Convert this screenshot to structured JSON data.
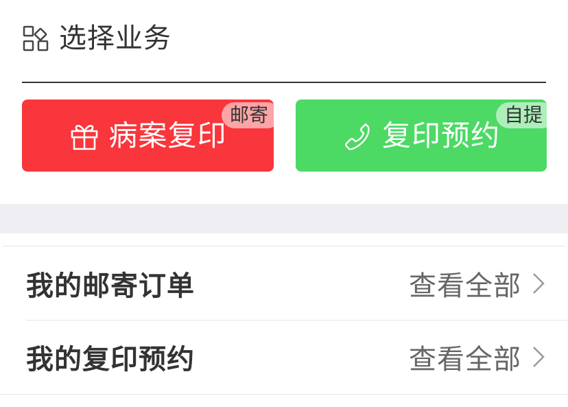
{
  "section": {
    "title": "选择业务",
    "icon": "grid-icon"
  },
  "actions": [
    {
      "label": "病案复印",
      "badge": "邮寄",
      "icon": "gift-icon",
      "color": "#f8363b"
    },
    {
      "label": "复印预约",
      "badge": "自提",
      "icon": "phone-icon",
      "color": "#4cd964"
    }
  ],
  "orders": [
    {
      "title": "我的邮寄订单",
      "more": "查看全部"
    },
    {
      "title": "我的复印预约",
      "more": "查看全部"
    }
  ]
}
